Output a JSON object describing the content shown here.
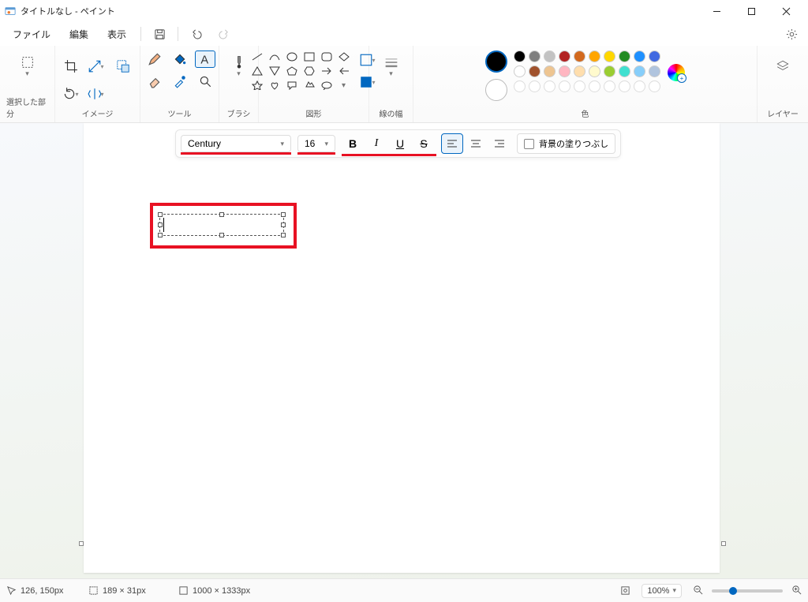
{
  "title": "タイトルなし - ペイント",
  "menus": {
    "file": "ファイル",
    "edit": "編集",
    "view": "表示"
  },
  "ribbon": {
    "select": "選択した部分",
    "image": "イメージ",
    "tools": "ツール",
    "brush": "ブラシ",
    "shapes": "図形",
    "stroke": "線の幅",
    "color": "色",
    "layers": "レイヤー"
  },
  "text_toolbar": {
    "font": "Century",
    "size": "16",
    "fill_bg": "背景の塗りつぶし"
  },
  "colors_row1": [
    "#000000",
    "#7f7f7f",
    "#c3c3c3",
    "#b22222",
    "#d2691e",
    "#ffa500",
    "#ffd700",
    "#228b22",
    "#1e90ff",
    "#4169e1"
  ],
  "colors_row2": [
    "#ffffff",
    "#a0522d",
    "#eec591",
    "#ffb6c1",
    "#ffdead",
    "#fffacd",
    "#9acd32",
    "#40e0d0",
    "#87cefa",
    "#b0c4de"
  ],
  "status": {
    "cursor": "126, 150px",
    "selection": "189 × 31px",
    "canvas": "1000 × 1333px",
    "zoom": "100%"
  }
}
